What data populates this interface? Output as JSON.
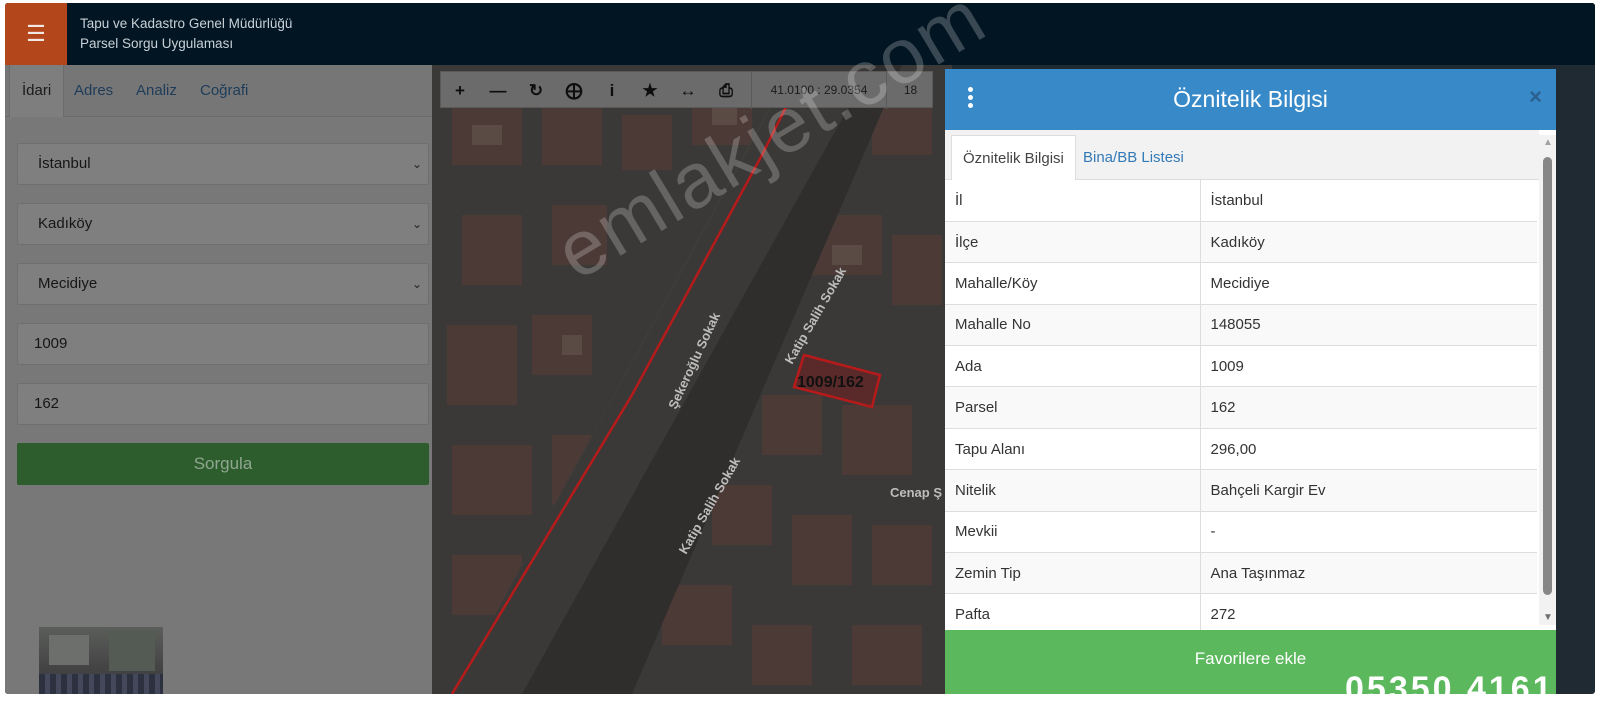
{
  "header": {
    "menu_icon": "hamburger-icon",
    "org": "Tapu ve Kadastro Genel Müdürlüğü",
    "app": "Parsel Sorgu Uygulaması"
  },
  "tabs": [
    "İdari",
    "Adres",
    "Analiz",
    "Coğrafi"
  ],
  "form": {
    "il": "İstanbul",
    "ilce": "Kadıköy",
    "mahalle": "Mecidiye",
    "ada": "1009",
    "parsel": "162",
    "submit": "Sorgula"
  },
  "map": {
    "coords": "41.0100 : 29.0354",
    "zoom": "18",
    "parcel_label": "1009/162",
    "streets": [
      "Şekeroğlu Sokak",
      "Katip Salih Sokak",
      "Katip Salih Sokak",
      "Cenap Ş"
    ],
    "tools": [
      "zoom-in-icon",
      "zoom-out-icon",
      "refresh-icon",
      "locate-icon",
      "info-icon",
      "favorite-star-icon",
      "measure-icon",
      "print-icon"
    ]
  },
  "attr_panel": {
    "title": "Öznitelik Bilgisi",
    "close": "×",
    "tabs": [
      "Öznitelik Bilgisi",
      "Bina/BB Listesi"
    ],
    "rows": [
      {
        "key": "İl",
        "value": "İstanbul"
      },
      {
        "key": "İlçe",
        "value": "Kadıköy"
      },
      {
        "key": "Mahalle/Köy",
        "value": "Mecidiye"
      },
      {
        "key": "Mahalle No",
        "value": "148055"
      },
      {
        "key": "Ada",
        "value": "1009"
      },
      {
        "key": "Parsel",
        "value": "162"
      },
      {
        "key": "Tapu Alanı",
        "value": "296,00"
      },
      {
        "key": "Nitelik",
        "value": "Bahçeli Kargir Ev"
      },
      {
        "key": "Mevkii",
        "value": "-"
      },
      {
        "key": "Zemin Tip",
        "value": "Ana Taşınmaz"
      },
      {
        "key": "Pafta",
        "value": "272"
      }
    ],
    "favorite_button": "Favorilere ekle"
  },
  "overlay": {
    "watermark": "emlakjet.com",
    "phone_fragment": "05350 4161"
  },
  "colors": {
    "header_bg": "#021522",
    "menu_accent": "#b4461c",
    "panel_header": "#3789c8",
    "favorite_green": "#5cb85c",
    "parcel_outline": "#b71a1a"
  }
}
